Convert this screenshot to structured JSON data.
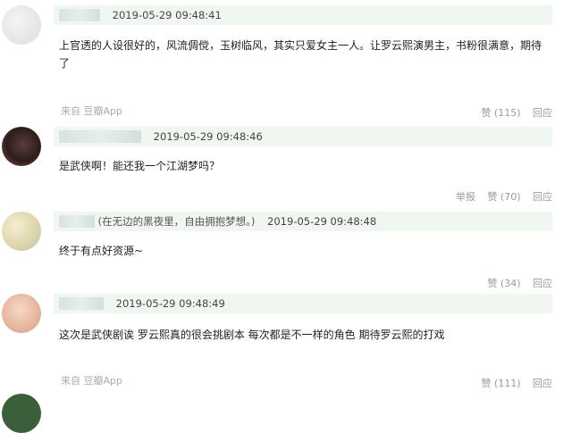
{
  "comments": [
    {
      "timestamp": "2019-05-29 09:48:41",
      "signature": "",
      "text": "上官透的人设很好的，风流倜傥，玉树临风，其实只爱女主一人。让罗云熙演男主，书粉很满意，期待了",
      "source": "来自 豆瓣App",
      "report": "",
      "like": "赞 (115)",
      "reply": "回应"
    },
    {
      "timestamp": "2019-05-29 09:48:46",
      "signature": "",
      "text": "是武侠啊！能还我一个江湖梦吗？",
      "source": "",
      "report": "举报",
      "like": "赞 (70)",
      "reply": "回应"
    },
    {
      "timestamp": "2019-05-29 09:48:48",
      "signature": "(在无边的黑夜里，自由拥抱梦想。)",
      "text": "终于有点好资源~",
      "source": "",
      "report": "",
      "like": "赞 (34)",
      "reply": "回应"
    },
    {
      "timestamp": "2019-05-29 09:48:49",
      "signature": "",
      "text": "这次是武侠剧诶 罗云熙真的很会挑剧本 每次都是不一样的角色 期待罗云熙的打戏",
      "source": "来自 豆瓣App",
      "report": "",
      "like": "赞 (111)",
      "reply": "回应"
    }
  ]
}
